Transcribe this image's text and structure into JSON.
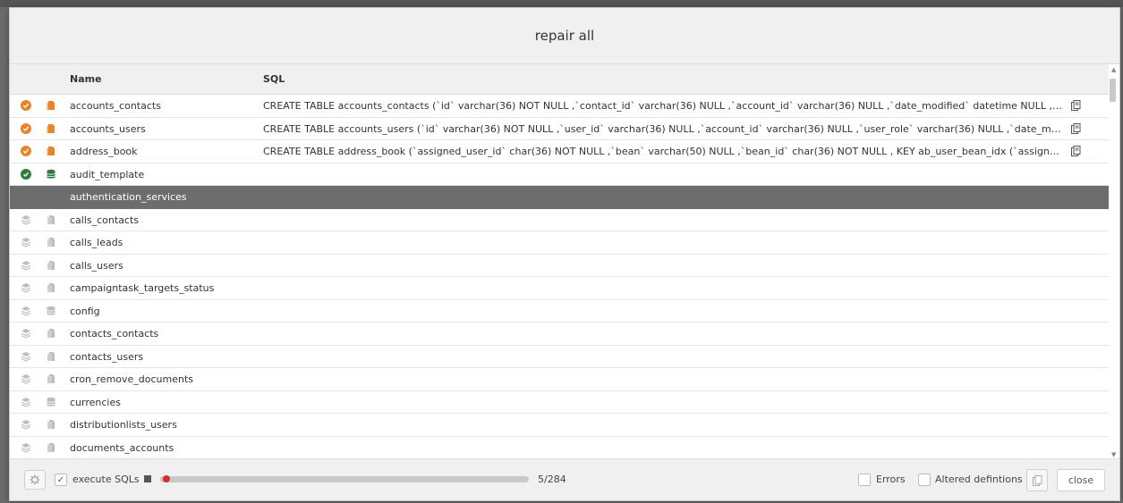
{
  "dialog": {
    "title": "repair all"
  },
  "columns": {
    "name": "Name",
    "sql": "SQL"
  },
  "rows": [
    {
      "status": "orange-check",
      "kind": "file-orange",
      "name": "accounts_contacts",
      "sql": "CREATE TABLE accounts_contacts (`id` varchar(36) NOT NULL ,`contact_id` varchar(36) NULL ,`account_id` varchar(36) NULL ,`date_modified` datetime NULL ,`deleted` bool DEFAUL...",
      "copy": true
    },
    {
      "status": "orange-check",
      "kind": "file-orange",
      "name": "accounts_users",
      "sql": "CREATE TABLE accounts_users (`id` varchar(36) NOT NULL ,`user_id` varchar(36) NULL ,`account_id` varchar(36) NULL ,`user_role` varchar(36) NULL ,`date_modified` datetime NUL...",
      "copy": true
    },
    {
      "status": "orange-check",
      "kind": "file-orange",
      "name": "address_book",
      "sql": "CREATE TABLE address_book (`assigned_user_id` char(36) NOT NULL ,`bean` varchar(50) NULL ,`bean_id` char(36) NOT NULL , KEY ab_user_bean_idx (`assigned_user_id`, `bean`)) ...",
      "copy": true
    },
    {
      "status": "green-check",
      "kind": "db-green",
      "name": "audit_template",
      "sql": "",
      "copy": false
    },
    {
      "status": "none",
      "kind": "none",
      "name": "authentication_services",
      "sql": "",
      "copy": false,
      "selected": true
    },
    {
      "status": "layers",
      "kind": "file-gray",
      "name": "calls_contacts",
      "sql": "",
      "copy": false
    },
    {
      "status": "layers",
      "kind": "file-gray",
      "name": "calls_leads",
      "sql": "",
      "copy": false
    },
    {
      "status": "layers",
      "kind": "file-gray",
      "name": "calls_users",
      "sql": "",
      "copy": false
    },
    {
      "status": "layers",
      "kind": "file-gray",
      "name": "campaigntask_targets_status",
      "sql": "",
      "copy": false
    },
    {
      "status": "layers",
      "kind": "db-gray",
      "name": "config",
      "sql": "",
      "copy": false
    },
    {
      "status": "layers",
      "kind": "file-gray",
      "name": "contacts_contacts",
      "sql": "",
      "copy": false
    },
    {
      "status": "layers",
      "kind": "file-gray",
      "name": "contacts_users",
      "sql": "",
      "copy": false
    },
    {
      "status": "layers",
      "kind": "file-gray",
      "name": "cron_remove_documents",
      "sql": "",
      "copy": false
    },
    {
      "status": "layers",
      "kind": "db-gray",
      "name": "currencies",
      "sql": "",
      "copy": false
    },
    {
      "status": "layers",
      "kind": "file-gray",
      "name": "distributionlists_users",
      "sql": "",
      "copy": false
    },
    {
      "status": "layers",
      "kind": "file-gray",
      "name": "documents_accounts",
      "sql": "",
      "copy": false
    }
  ],
  "footer": {
    "execute_label": "execute SQLs",
    "execute_checked": true,
    "progress_text": "5/284",
    "progress_fraction": 0.0176,
    "errors_label": "Errors",
    "altered_label": "Altered defintions",
    "close_label": "close"
  },
  "colors": {
    "orange": "#e8852a",
    "green": "#2f7d3b",
    "selected_row": "#6d6d6d",
    "progress_dot": "#d32f2f"
  }
}
